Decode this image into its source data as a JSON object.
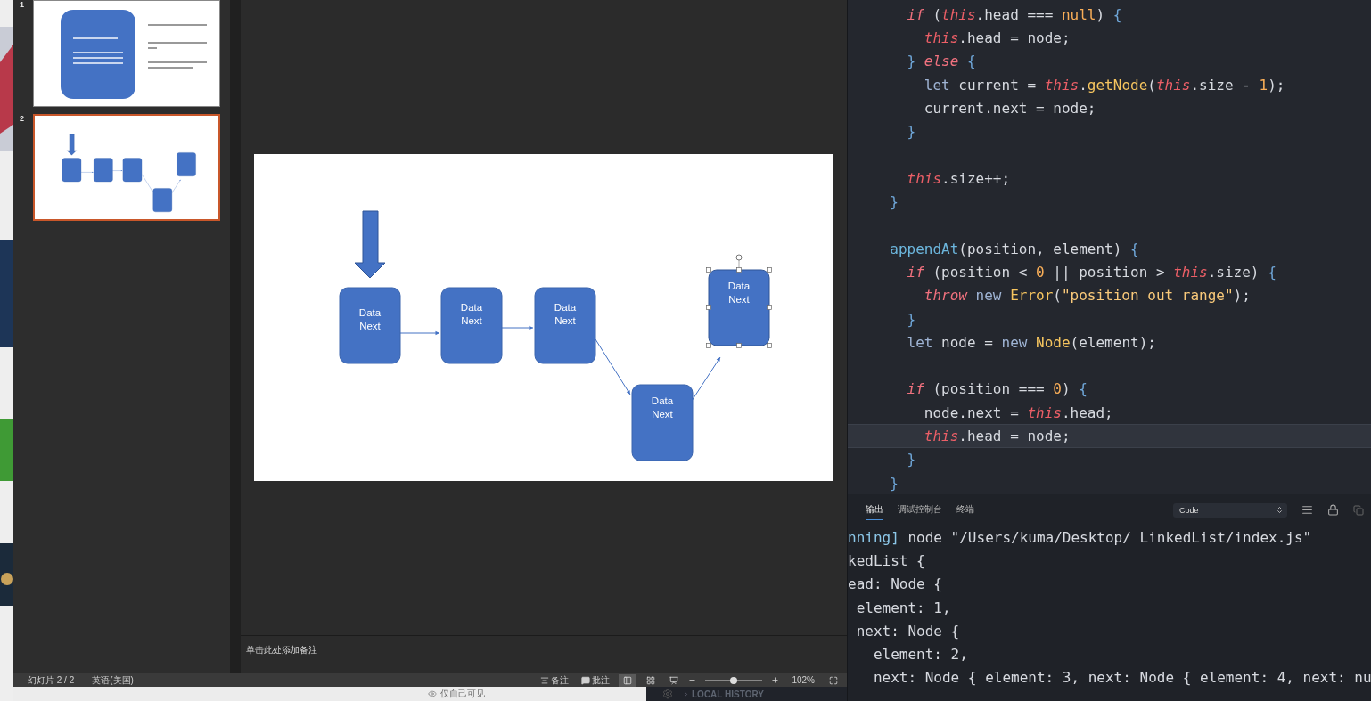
{
  "slides_pane": {
    "slides": [
      {
        "number": "1",
        "selected": false,
        "kind": "title"
      },
      {
        "number": "2",
        "selected": true,
        "kind": "diagram"
      }
    ]
  },
  "slide": {
    "nodes": [
      {
        "lines": [
          "Data",
          "Next"
        ],
        "selected": false
      },
      {
        "lines": [
          "Data",
          "Next"
        ],
        "selected": false
      },
      {
        "lines": [
          "Data",
          "Next"
        ],
        "selected": false
      },
      {
        "lines": [
          "Data",
          "Next"
        ],
        "selected": false
      },
      {
        "lines": [
          "Data",
          "Next"
        ],
        "selected": true
      }
    ]
  },
  "notes": {
    "placeholder": "单击此处添加备注"
  },
  "status_bar": {
    "slide_counter": "幻灯片 2 / 2",
    "language": "英语(美国)",
    "notes_button": "备注",
    "comments_button": "批注",
    "views": [
      {
        "kind": "normal",
        "selected": true
      },
      {
        "kind": "sorter",
        "selected": false
      },
      {
        "kind": "presenter",
        "selected": false
      }
    ],
    "zoom": {
      "level": 0.5,
      "reading": "102%"
    }
  },
  "background": {
    "visibility": "仅自己可见",
    "sidebar_section": "LOCAL HISTORY"
  },
  "editor": {
    "lines": [
      {
        "kind": "code",
        "current": false,
        "tokens": [
          {
            "text": "    if",
            "kind": "kw"
          },
          {
            "text": " (",
            "kind": "plain"
          },
          {
            "text": "this",
            "kind": "this"
          },
          {
            "text": ".head === ",
            "kind": "plain"
          },
          {
            "text": "null",
            "kind": "lit"
          },
          {
            "text": ") ",
            "kind": "plain"
          },
          {
            "text": "{",
            "kind": "brace"
          }
        ]
      },
      {
        "kind": "code",
        "current": false,
        "tokens": [
          {
            "text": "      this",
            "kind": "this"
          },
          {
            "text": ".head = node;",
            "kind": "plain"
          }
        ]
      },
      {
        "kind": "code",
        "current": false,
        "tokens": [
          {
            "text": "    }",
            "kind": "brace"
          },
          {
            "text": " else",
            "kind": "kw"
          },
          {
            "text": " {",
            "kind": "brace"
          }
        ]
      },
      {
        "kind": "code",
        "current": false,
        "tokens": [
          {
            "text": "      let",
            "kind": "decl"
          },
          {
            "text": " current = ",
            "kind": "plain"
          },
          {
            "text": "this",
            "kind": "this"
          },
          {
            "text": ".",
            "kind": "plain"
          },
          {
            "text": "getNode",
            "kind": "fn"
          },
          {
            "text": "(",
            "kind": "plain"
          },
          {
            "text": "this",
            "kind": "this"
          },
          {
            "text": ".size - ",
            "kind": "plain"
          },
          {
            "text": "1",
            "kind": "num"
          },
          {
            "text": ");",
            "kind": "plain"
          }
        ]
      },
      {
        "kind": "code",
        "current": false,
        "tokens": [
          {
            "text": "      current.next = node;",
            "kind": "plain"
          }
        ]
      },
      {
        "kind": "code",
        "current": false,
        "tokens": [
          {
            "text": "    }",
            "kind": "brace"
          }
        ]
      },
      {
        "kind": "blank"
      },
      {
        "kind": "code",
        "current": false,
        "tokens": [
          {
            "text": "    this",
            "kind": "this"
          },
          {
            "text": ".size++;",
            "kind": "plain"
          }
        ]
      },
      {
        "kind": "code",
        "current": false,
        "tokens": [
          {
            "text": "  }",
            "kind": "brace"
          }
        ]
      },
      {
        "kind": "blank"
      },
      {
        "kind": "code",
        "current": false,
        "tokens": [
          {
            "text": "  appendAt",
            "kind": "def"
          },
          {
            "text": "(position, element) ",
            "kind": "plain"
          },
          {
            "text": "{",
            "kind": "brace"
          }
        ]
      },
      {
        "kind": "code",
        "current": false,
        "tokens": [
          {
            "text": "    if",
            "kind": "kw"
          },
          {
            "text": " (position < ",
            "kind": "plain"
          },
          {
            "text": "0",
            "kind": "num"
          },
          {
            "text": " || position > ",
            "kind": "plain"
          },
          {
            "text": "this",
            "kind": "this"
          },
          {
            "text": ".size) ",
            "kind": "plain"
          },
          {
            "text": "{",
            "kind": "brace"
          }
        ]
      },
      {
        "kind": "code",
        "current": false,
        "tokens": [
          {
            "text": "      throw",
            "kind": "kw"
          },
          {
            "text": " new",
            "kind": "decl"
          },
          {
            "text": " Error",
            "kind": "fn"
          },
          {
            "text": "(",
            "kind": "plain"
          },
          {
            "text": "\"position out range\"",
            "kind": "str"
          },
          {
            "text": ");",
            "kind": "plain"
          }
        ]
      },
      {
        "kind": "code",
        "current": false,
        "tokens": [
          {
            "text": "    }",
            "kind": "brace"
          }
        ]
      },
      {
        "kind": "code",
        "current": false,
        "tokens": [
          {
            "text": "    let",
            "kind": "decl"
          },
          {
            "text": " node = ",
            "kind": "plain"
          },
          {
            "text": "new",
            "kind": "decl"
          },
          {
            "text": " Node",
            "kind": "fn"
          },
          {
            "text": "(element);",
            "kind": "plain"
          }
        ]
      },
      {
        "kind": "blank"
      },
      {
        "kind": "code",
        "current": false,
        "tokens": [
          {
            "text": "    if",
            "kind": "kw"
          },
          {
            "text": " (position === ",
            "kind": "plain"
          },
          {
            "text": "0",
            "kind": "num"
          },
          {
            "text": ") ",
            "kind": "plain"
          },
          {
            "text": "{",
            "kind": "brace"
          }
        ]
      },
      {
        "kind": "code",
        "current": false,
        "tokens": [
          {
            "text": "      node.next = ",
            "kind": "plain"
          },
          {
            "text": "this",
            "kind": "this"
          },
          {
            "text": ".head;",
            "kind": "plain"
          }
        ]
      },
      {
        "kind": "code",
        "current": true,
        "tokens": [
          {
            "text": "      this",
            "kind": "this"
          },
          {
            "text": ".head = node;",
            "kind": "plain"
          }
        ]
      },
      {
        "kind": "code",
        "current": false,
        "tokens": [
          {
            "text": "    }",
            "kind": "brace"
          }
        ]
      },
      {
        "kind": "code",
        "current": false,
        "tokens": [
          {
            "text": "  }",
            "kind": "brace"
          }
        ]
      }
    ]
  },
  "panel": {
    "tabs": [
      {
        "label": "输出",
        "selected": true
      },
      {
        "label": "调试控制台",
        "selected": false
      },
      {
        "label": "终端",
        "selected": false
      }
    ],
    "channel": "Code",
    "output": [
      {
        "tokens": [
          {
            "text": "nning]",
            "kind": "tag"
          },
          {
            "text": " node \"/Users/kuma/Desktop/ LinkedList/index.js\"",
            "kind": "plain"
          }
        ]
      },
      {
        "tokens": [
          {
            "text": "kedList {",
            "kind": "plain"
          }
        ]
      },
      {
        "tokens": [
          {
            "text": "ead: Node {",
            "kind": "plain"
          }
        ]
      },
      {
        "tokens": [
          {
            "text": " element: 1,",
            "kind": "plain"
          }
        ]
      },
      {
        "tokens": [
          {
            "text": " next: Node {",
            "kind": "plain"
          }
        ]
      },
      {
        "tokens": [
          {
            "text": "   element: 2,",
            "kind": "plain"
          }
        ]
      },
      {
        "tokens": [
          {
            "text": "   next: Node { element: 3, next: Node { element: 4, next: nu",
            "kind": "plain"
          }
        ]
      }
    ]
  }
}
